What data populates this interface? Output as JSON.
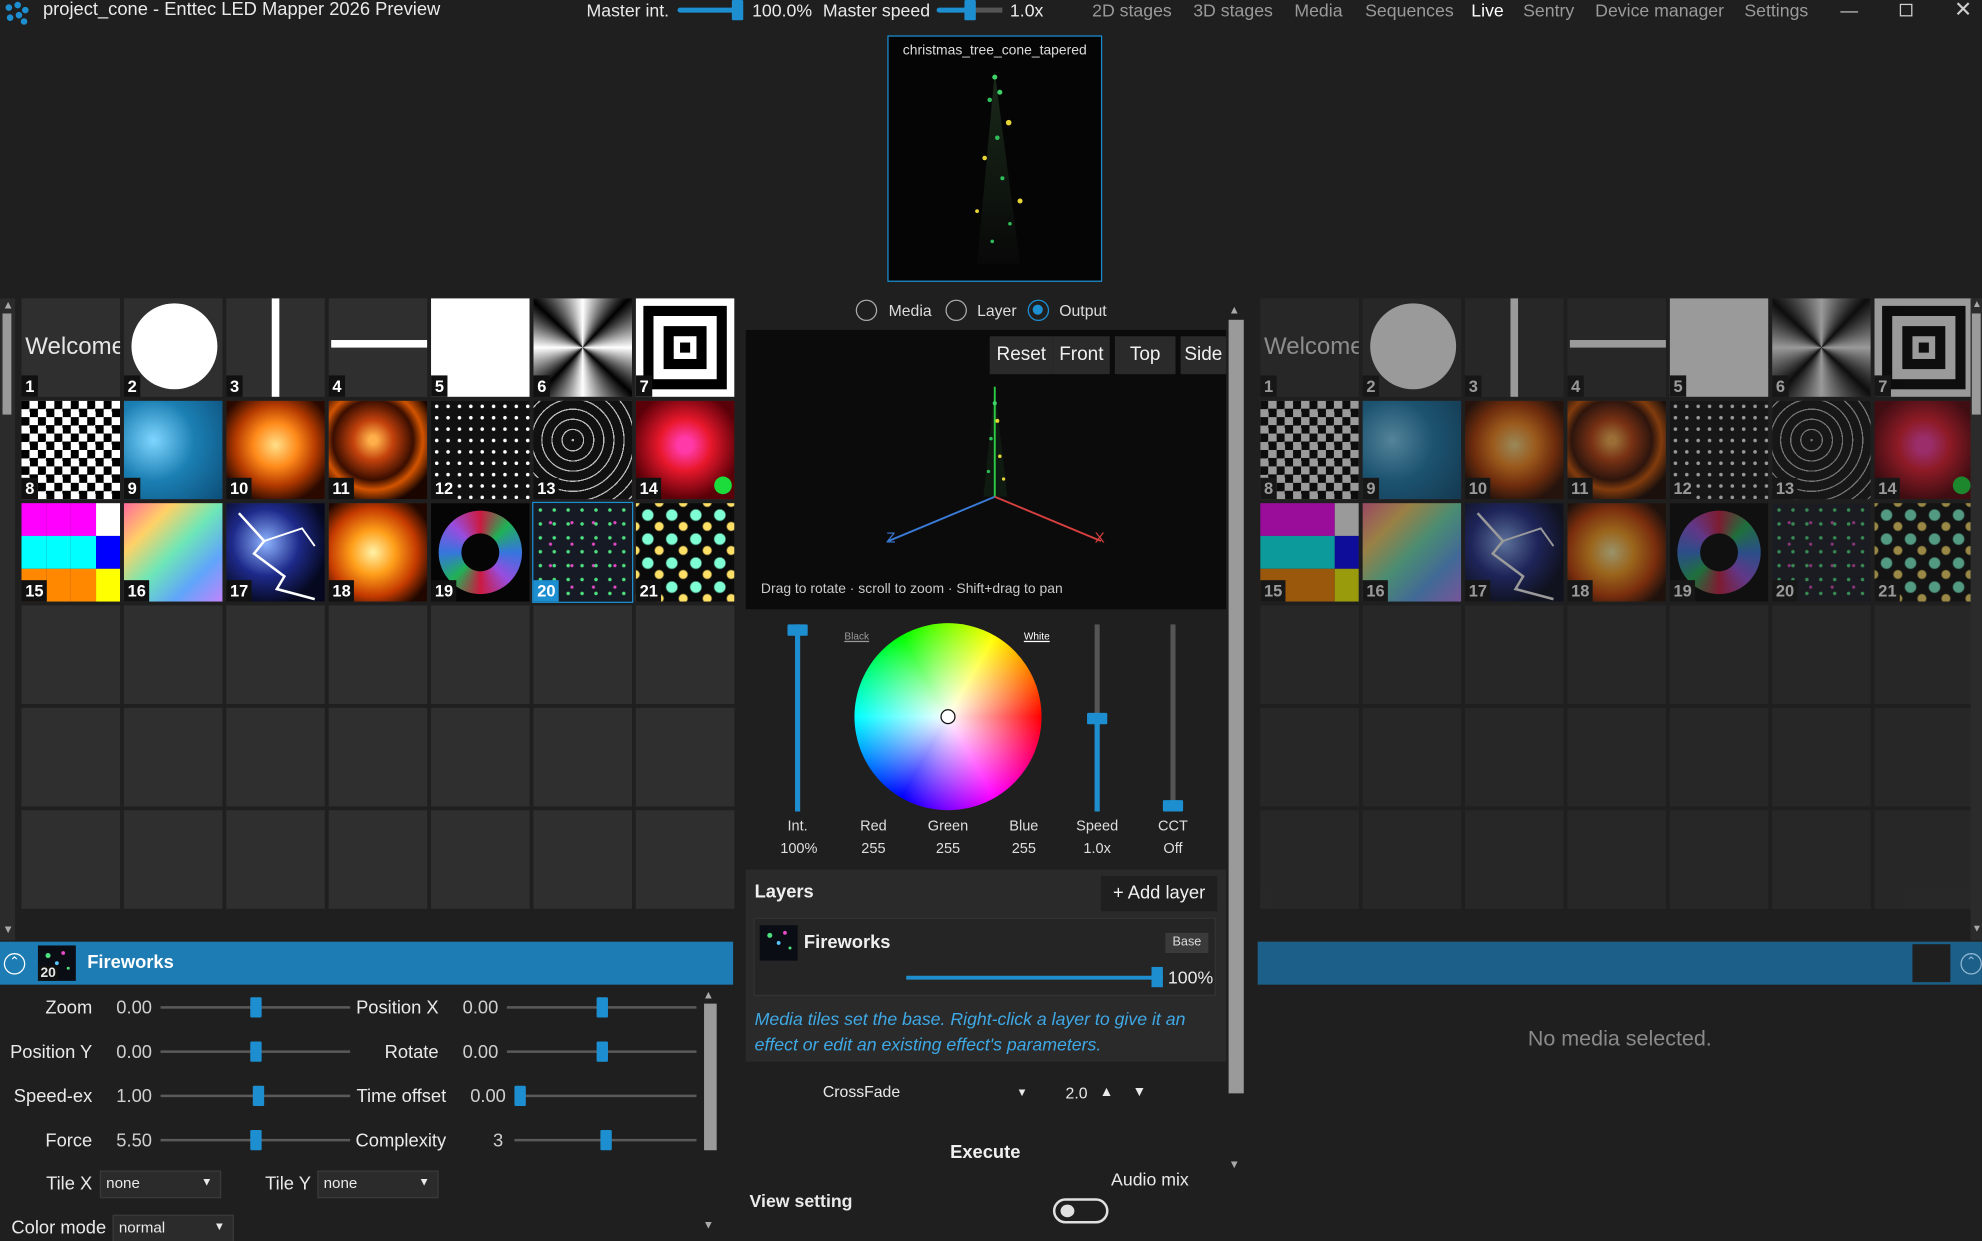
{
  "titlebar": {
    "app_title": "project_cone - Enttec LED Mapper 2026 Preview",
    "master_int_label": "Master int.",
    "master_int_value": "100.0%",
    "master_int_fraction": 1.0,
    "master_speed_label": "Master speed",
    "master_speed_value": "1.0x",
    "master_speed_fraction": 0.5,
    "nav": [
      "2D stages",
      "3D stages",
      "Media",
      "Sequences",
      "Live",
      "Sentry",
      "Device manager",
      "Settings"
    ],
    "nav_active": "Live",
    "minimize_icon": "minimize-icon",
    "maximize_icon": "maximize-icon",
    "close_icon": "close-icon"
  },
  "preview": {
    "title": "christmas_tree_cone_tapered"
  },
  "left_grid": {
    "tiles": [
      {
        "n": "1",
        "kind": "welcome",
        "label": "Welcome"
      },
      {
        "n": "2",
        "kind": "circle"
      },
      {
        "n": "3",
        "kind": "vline"
      },
      {
        "n": "4",
        "kind": "hline"
      },
      {
        "n": "5",
        "kind": "white"
      },
      {
        "n": "6",
        "kind": "radial"
      },
      {
        "n": "7",
        "kind": "squares"
      },
      {
        "n": "8",
        "kind": "diamond"
      },
      {
        "n": "9",
        "kind": "water"
      },
      {
        "n": "10",
        "kind": "fire"
      },
      {
        "n": "11",
        "kind": "spiral"
      },
      {
        "n": "12",
        "kind": "dots"
      },
      {
        "n": "13",
        "kind": "lines"
      },
      {
        "n": "14",
        "kind": "blob"
      },
      {
        "n": "15",
        "kind": "colorbars"
      },
      {
        "n": "16",
        "kind": "hex"
      },
      {
        "n": "17",
        "kind": "lightning"
      },
      {
        "n": "18",
        "kind": "fire2"
      },
      {
        "n": "19",
        "kind": "kaleido"
      },
      {
        "n": "20",
        "kind": "fireworks"
      },
      {
        "n": "21",
        "kind": "rings"
      }
    ],
    "selected": "20"
  },
  "effect_panel": {
    "number": "20",
    "name": "Fireworks",
    "collapse_icon": "chevron-up-icon",
    "params": [
      {
        "label": "Zoom",
        "value": "0.00",
        "level": 0.5
      },
      {
        "label": "Position X",
        "value": "0.00",
        "level": 0.5
      },
      {
        "label": "Position Y",
        "value": "0.00",
        "level": 0.5
      },
      {
        "label": "Rotate",
        "value": "0.00",
        "level": 0.5
      },
      {
        "label": "Speed-ex",
        "value": "1.00",
        "level": 0.52
      },
      {
        "label": "Time offset",
        "value": "0.00",
        "level": 0.0
      },
      {
        "label": "Force",
        "value": "5.50",
        "level": 0.5
      },
      {
        "label": "Complexity",
        "value": "3",
        "level": 0.5
      }
    ],
    "tile_x_label": "Tile X",
    "tile_x_value": "none",
    "tile_y_label": "Tile Y",
    "tile_y_value": "none",
    "color_mode_label": "Color mode",
    "color_mode_value": "normal"
  },
  "view_mode": {
    "options": [
      "Media",
      "Layer",
      "Output"
    ],
    "selected": "Output"
  },
  "viewport": {
    "buttons": [
      "Reset",
      "Front",
      "Top",
      "Side"
    ],
    "hint": "Drag to rotate · scroll to zoom · Shift+drag to pan",
    "axis_x": "X",
    "axis_z": "Z"
  },
  "color_panel": {
    "black_label": "Black",
    "white_label": "White",
    "int_label": "Int.",
    "int_value": "100%",
    "int_level": 1.0,
    "red_label": "Red",
    "red_value": "255",
    "green_label": "Green",
    "green_value": "255",
    "blue_label": "Blue",
    "blue_value": "255",
    "speed_label": "Speed",
    "speed_value": "1.0x",
    "speed_level": 0.5,
    "cct_label": "CCT",
    "cct_value": "Off",
    "cct_level": 0.0
  },
  "layers": {
    "title": "Layers",
    "add_button": "+ Add layer",
    "items": [
      {
        "name": "Fireworks",
        "badge": "Base",
        "opacity": "100%",
        "opacity_level": 1.0
      }
    ],
    "hint": "Media tiles set the base. Right-click a layer to give it an effect or edit an existing effect's parameters."
  },
  "transition": {
    "type": "CrossFade",
    "time": "2.0",
    "execute_label": "Execute",
    "audio_mix_label": "Audio mix",
    "view_setting_label": "View setting"
  },
  "right_grid": {
    "status_text": "No media selected."
  },
  "colors": {
    "accent": "#1d8fd1",
    "panel_header": "#1d7cb3",
    "background": "#1f1f1f",
    "hint_blue": "#3fa9e6"
  }
}
